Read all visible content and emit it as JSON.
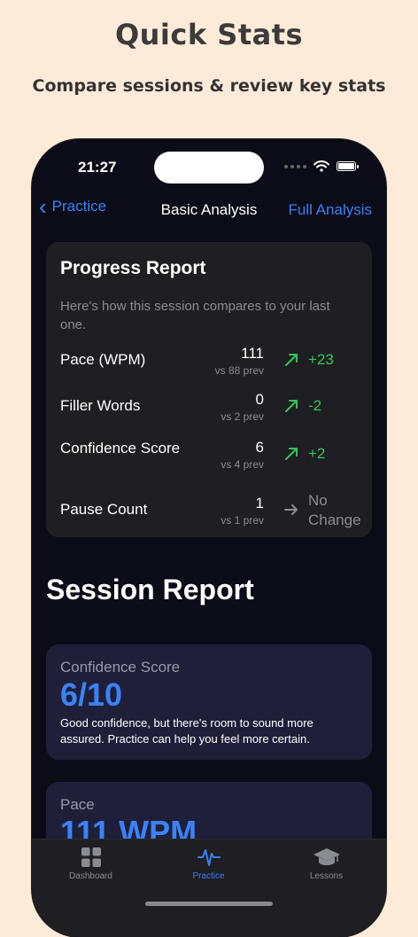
{
  "promo": {
    "headline": "Quick Stats",
    "subline": "Compare sessions & review key stats"
  },
  "status_bar": {
    "time": "21:27"
  },
  "nav": {
    "back_label": "Practice",
    "title": "Basic Analysis",
    "right_label": "Full Analysis"
  },
  "progress_report": {
    "title": "Progress Report",
    "description": "Here's how this session compares to your last one.",
    "metrics": [
      {
        "label": "Pace (WPM)",
        "value": "111",
        "prev": "vs 88 prev",
        "delta": "+23",
        "trend": "up"
      },
      {
        "label": "Filler Words",
        "value": "0",
        "prev": "vs 2 prev",
        "delta": "-2",
        "trend": "up"
      },
      {
        "label": "Confidence Score",
        "value": "6",
        "prev": "vs 4 prev",
        "delta": "+2",
        "trend": "up"
      },
      {
        "label": "Pause Count",
        "value": "1",
        "prev": "vs 1 prev",
        "delta": "No Change",
        "trend": "flat"
      }
    ]
  },
  "session_report": {
    "title": "Session Report",
    "confidence": {
      "label": "Confidence Score",
      "value": "6/10",
      "description": "Good confidence, but there's room to sound more assured. Practice can help you feel more certain."
    },
    "pace": {
      "label": "Pace",
      "value": "111 WPM"
    }
  },
  "tabbar": {
    "items": [
      {
        "label": "Dashboard",
        "icon": "grid-icon",
        "active": false
      },
      {
        "label": "Practice",
        "icon": "waveform-icon",
        "active": true
      },
      {
        "label": "Lessons",
        "icon": "graduation-cap-icon",
        "active": false
      }
    ]
  },
  "colors": {
    "background": "#fdebd9",
    "accent": "#3b82f6",
    "positive": "#34c759",
    "card": "#1e1e23",
    "session_card": "#1f1f3a"
  }
}
